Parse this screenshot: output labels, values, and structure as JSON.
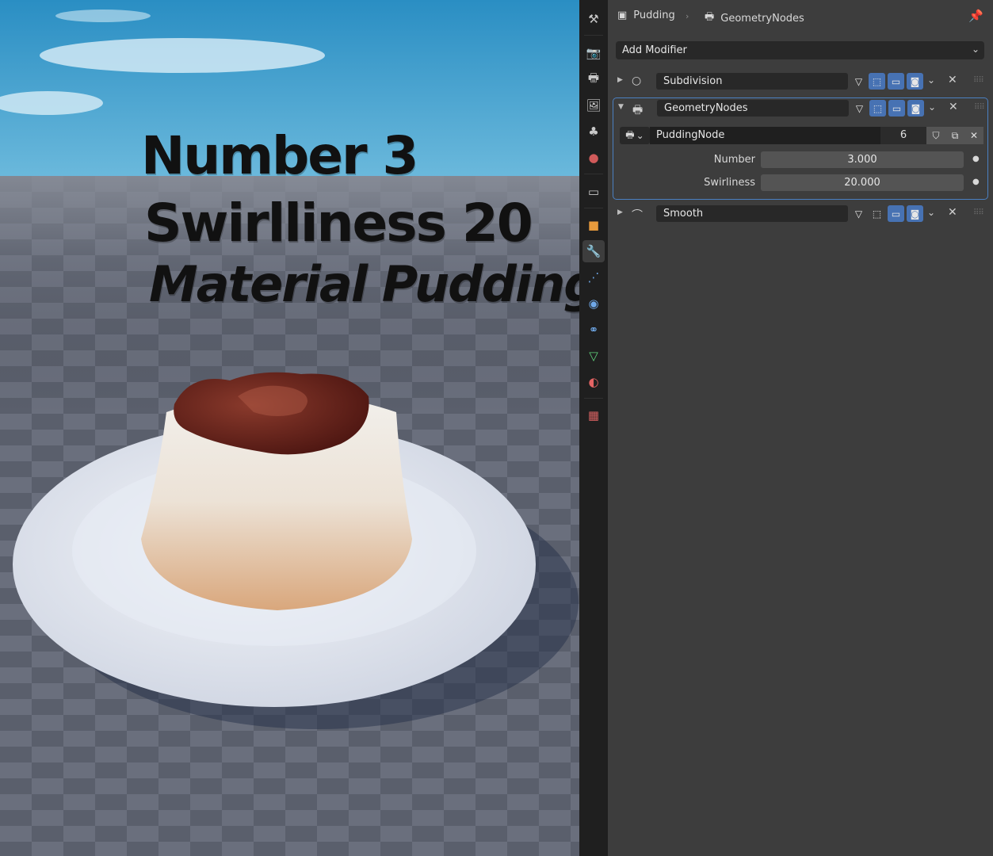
{
  "viewport": {
    "overlay_lines": [
      "Number 3",
      "Swirlliness 20",
      "Material Pudding"
    ]
  },
  "tabs": [
    {
      "name": "tool-tab",
      "icon": "tool-icon"
    },
    {
      "name": "render-tab",
      "icon": "render-icon"
    },
    {
      "name": "output-tab",
      "icon": "output-icon"
    },
    {
      "name": "view-layer-tab",
      "icon": "view-layer-icon"
    },
    {
      "name": "scene-tab",
      "icon": "scene-icon"
    },
    {
      "name": "world-tab",
      "icon": "world-icon"
    },
    {
      "name": "collection-tab",
      "icon": "collection-icon"
    },
    {
      "name": "object-tab",
      "icon": "object-icon"
    },
    {
      "name": "modifier-tab",
      "icon": "wrench-icon",
      "active": true
    },
    {
      "name": "particles-tab",
      "icon": "particles-icon"
    },
    {
      "name": "physics-tab",
      "icon": "physics-icon"
    },
    {
      "name": "constraints-tab",
      "icon": "constraint-icon"
    },
    {
      "name": "data-tab",
      "icon": "mesh-data-icon"
    },
    {
      "name": "material-tab",
      "icon": "material-icon"
    },
    {
      "name": "texture-tab",
      "icon": "texture-icon"
    }
  ],
  "breadcrumb": {
    "object": "Pudding",
    "modifier": "GeometryNodes"
  },
  "add_modifier": "Add Modifier",
  "modifiers": {
    "subdivision": {
      "name": "Subdivision"
    },
    "geometry": {
      "name": "GeometryNodes",
      "node_group": "PuddingNode",
      "users": "6",
      "props": [
        {
          "label": "Number",
          "value": "3.000"
        },
        {
          "label": "Swirliness",
          "value": "20.000"
        }
      ]
    },
    "smooth": {
      "name": "Smooth"
    }
  },
  "colors": {
    "accent": "#4772b3",
    "panel_bg": "#3d3d3d",
    "field_bg": "#282828",
    "sky_top": "#2c8fc2",
    "ground": "#5f6473"
  }
}
